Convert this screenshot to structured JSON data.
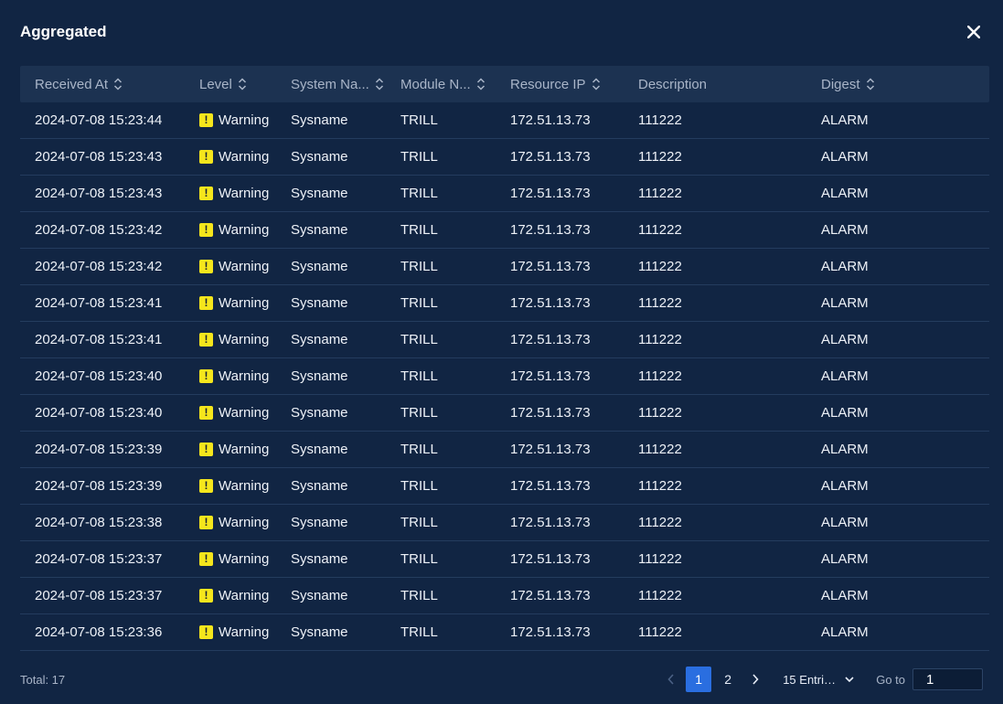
{
  "modal": {
    "title": "Aggregated"
  },
  "columns": [
    {
      "label": "Received At",
      "sortable": true
    },
    {
      "label": "Level",
      "sortable": true
    },
    {
      "label": "System Na...",
      "sortable": true
    },
    {
      "label": "Module N...",
      "sortable": true
    },
    {
      "label": "Resource IP",
      "sortable": true
    },
    {
      "label": "Description",
      "sortable": false
    },
    {
      "label": "Digest",
      "sortable": true
    }
  ],
  "rows": [
    {
      "received_at": "2024-07-08 15:23:44",
      "level": "Warning",
      "system_name": "Sysname",
      "module_name": "TRILL",
      "resource_ip": "172.51.13.73",
      "description": "111222",
      "digest": "ALARM"
    },
    {
      "received_at": "2024-07-08 15:23:43",
      "level": "Warning",
      "system_name": "Sysname",
      "module_name": "TRILL",
      "resource_ip": "172.51.13.73",
      "description": "111222",
      "digest": "ALARM"
    },
    {
      "received_at": "2024-07-08 15:23:43",
      "level": "Warning",
      "system_name": "Sysname",
      "module_name": "TRILL",
      "resource_ip": "172.51.13.73",
      "description": "111222",
      "digest": "ALARM"
    },
    {
      "received_at": "2024-07-08 15:23:42",
      "level": "Warning",
      "system_name": "Sysname",
      "module_name": "TRILL",
      "resource_ip": "172.51.13.73",
      "description": "111222",
      "digest": "ALARM"
    },
    {
      "received_at": "2024-07-08 15:23:42",
      "level": "Warning",
      "system_name": "Sysname",
      "module_name": "TRILL",
      "resource_ip": "172.51.13.73",
      "description": "111222",
      "digest": "ALARM"
    },
    {
      "received_at": "2024-07-08 15:23:41",
      "level": "Warning",
      "system_name": "Sysname",
      "module_name": "TRILL",
      "resource_ip": "172.51.13.73",
      "description": "111222",
      "digest": "ALARM"
    },
    {
      "received_at": "2024-07-08 15:23:41",
      "level": "Warning",
      "system_name": "Sysname",
      "module_name": "TRILL",
      "resource_ip": "172.51.13.73",
      "description": "111222",
      "digest": "ALARM"
    },
    {
      "received_at": "2024-07-08 15:23:40",
      "level": "Warning",
      "system_name": "Sysname",
      "module_name": "TRILL",
      "resource_ip": "172.51.13.73",
      "description": "111222",
      "digest": "ALARM"
    },
    {
      "received_at": "2024-07-08 15:23:40",
      "level": "Warning",
      "system_name": "Sysname",
      "module_name": "TRILL",
      "resource_ip": "172.51.13.73",
      "description": "111222",
      "digest": "ALARM"
    },
    {
      "received_at": "2024-07-08 15:23:39",
      "level": "Warning",
      "system_name": "Sysname",
      "module_name": "TRILL",
      "resource_ip": "172.51.13.73",
      "description": "111222",
      "digest": "ALARM"
    },
    {
      "received_at": "2024-07-08 15:23:39",
      "level": "Warning",
      "system_name": "Sysname",
      "module_name": "TRILL",
      "resource_ip": "172.51.13.73",
      "description": "111222",
      "digest": "ALARM"
    },
    {
      "received_at": "2024-07-08 15:23:38",
      "level": "Warning",
      "system_name": "Sysname",
      "module_name": "TRILL",
      "resource_ip": "172.51.13.73",
      "description": "111222",
      "digest": "ALARM"
    },
    {
      "received_at": "2024-07-08 15:23:37",
      "level": "Warning",
      "system_name": "Sysname",
      "module_name": "TRILL",
      "resource_ip": "172.51.13.73",
      "description": "111222",
      "digest": "ALARM"
    },
    {
      "received_at": "2024-07-08 15:23:37",
      "level": "Warning",
      "system_name": "Sysname",
      "module_name": "TRILL",
      "resource_ip": "172.51.13.73",
      "description": "111222",
      "digest": "ALARM"
    },
    {
      "received_at": "2024-07-08 15:23:36",
      "level": "Warning",
      "system_name": "Sysname",
      "module_name": "TRILL",
      "resource_ip": "172.51.13.73",
      "description": "111222",
      "digest": "ALARM"
    }
  ],
  "level_icon": {
    "name": "warning-icon",
    "glyph": "!",
    "color": "#f5e61c"
  },
  "footer": {
    "total_label": "Total: 17",
    "pages": [
      "1",
      "2"
    ],
    "current_page": "1",
    "page_size_label": "15 Entries/Page",
    "goto_label": "Go to",
    "goto_value": "1"
  },
  "colors": {
    "background": "#112543",
    "header_bg": "#1c3251",
    "accent": "#2a6ee0",
    "warning": "#f5e61c"
  }
}
